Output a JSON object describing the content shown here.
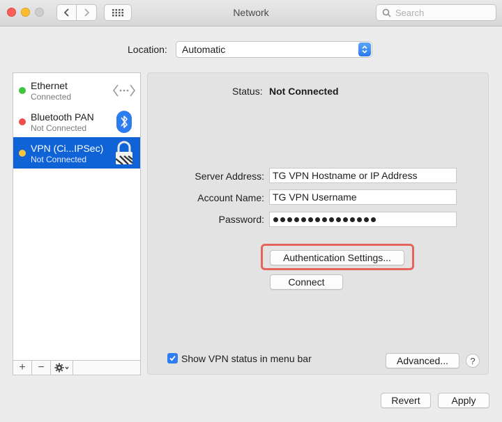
{
  "window": {
    "title": "Network"
  },
  "search": {
    "placeholder": "Search"
  },
  "location": {
    "label": "Location:",
    "value": "Automatic"
  },
  "services": [
    {
      "name": "Ethernet",
      "status": "Connected",
      "dot_color": "#3ec63e",
      "icon": "ethernet-icon",
      "selected": false
    },
    {
      "name": "Bluetooth PAN",
      "status": "Not Connected",
      "dot_color": "#f24c4c",
      "icon": "bluetooth-icon",
      "selected": false
    },
    {
      "name": "VPN (Ci...IPSec)",
      "status": "Not Connected",
      "dot_color": "#f5c43c",
      "icon": "vpn-lock-icon",
      "selected": true
    }
  ],
  "sidebar_toolbar": {
    "add": "+",
    "remove": "−"
  },
  "detail": {
    "status_label": "Status:",
    "status_value": "Not Connected",
    "server_label": "Server Address:",
    "server_value": "TG VPN Hostname or IP Address",
    "account_label": "Account Name:",
    "account_value": "TG VPN Username",
    "password_label": "Password:",
    "password_length": 15,
    "auth_button": "Authentication Settings...",
    "connect_button": "Connect",
    "show_status_label": "Show VPN status in menu bar",
    "show_status_checked": true,
    "advanced_button": "Advanced...",
    "help": "?"
  },
  "footer": {
    "revert": "Revert",
    "apply": "Apply"
  },
  "colors": {
    "selection": "#0f63d6",
    "highlight": "#e5645b",
    "accent": "#2f7cf3"
  }
}
